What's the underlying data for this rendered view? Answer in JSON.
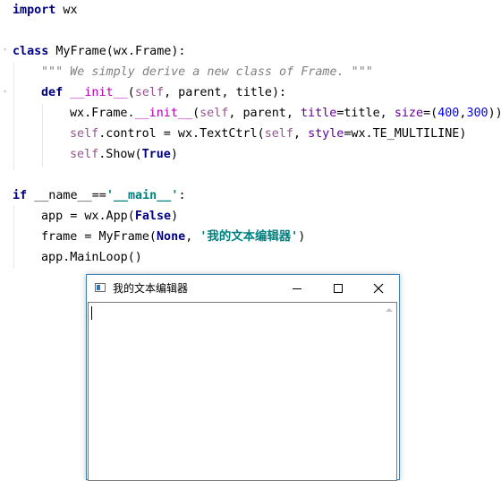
{
  "code": {
    "line1": {
      "kw": "import",
      "rest": " wx"
    },
    "line3": {
      "kw": "class",
      "rest": " MyFrame(wx.Frame):"
    },
    "line4": {
      "doc": "\"\"\" We simply derive a new class of Frame. \"\"\""
    },
    "line5": {
      "kw": "def",
      "sp": " ",
      "name": "__init__",
      "a": "(",
      "self": "self",
      "b": ", parent, title):"
    },
    "line6": {
      "a": "wx.Frame.",
      "init": "__init__",
      "b": "(",
      "self": "self",
      "c": ", parent, ",
      "p1": "title",
      "d": "=title, ",
      "p2": "size",
      "e": "=(",
      "n1": "400",
      "f": ",",
      "n2": "300",
      "g": "))"
    },
    "line7": {
      "self": "self",
      "a": ".control = wx.TextCtrl(",
      "self2": "self",
      "b": ", ",
      "p1": "style",
      "c": "=wx.TE_MULTILINE)"
    },
    "line8": {
      "self": "self",
      "a": ".Show(",
      "kw": "True",
      "b": ")"
    },
    "line10": {
      "kw": "if",
      "a": " ",
      "name": "__name__",
      "b": "==",
      "str": "'__main__'",
      "c": ":"
    },
    "line11": {
      "a": "app = wx.App(",
      "kw": "False",
      "b": ")"
    },
    "line12": {
      "a": "frame = MyFrame(",
      "kw": "None",
      "b": ", ",
      "str": "'我的文本编辑器'",
      "c": ")"
    },
    "line13": {
      "a": "app.MainLoop()"
    }
  },
  "window": {
    "title": "我的文本编辑器",
    "icon": "app-window-icon",
    "minimize_icon": "minimize-icon",
    "maximize_icon": "maximize-icon",
    "close_icon": "close-icon",
    "textctrl_value": ""
  }
}
